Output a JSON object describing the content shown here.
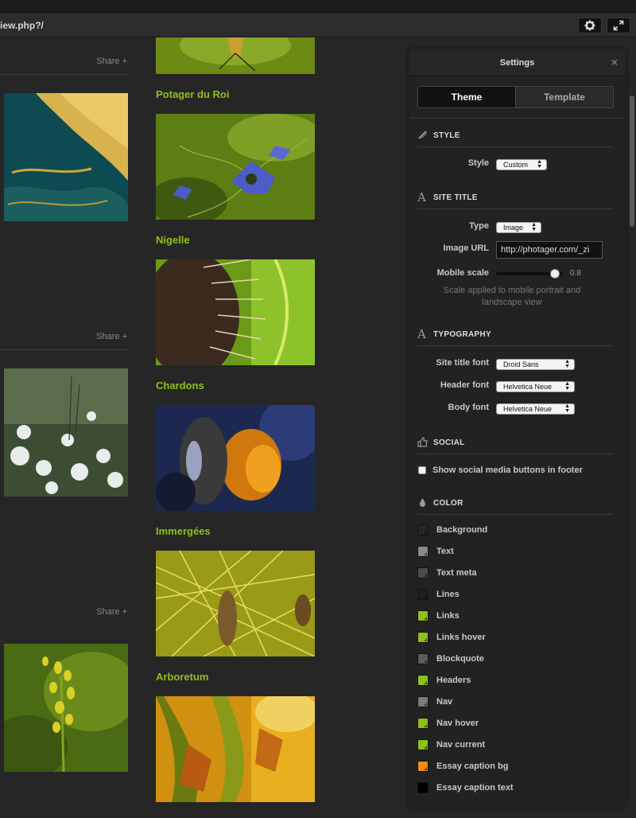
{
  "browser": {
    "url": "iew.php?/",
    "settings_button": "gear-icon",
    "fullscreen_button": "expand-icon"
  },
  "left_column": {
    "share_labels": [
      "Share +",
      "Share +",
      "Share +"
    ]
  },
  "gallery": {
    "titles": [
      "Potager du Roi",
      "Nigelle",
      "Chardons",
      "Immergées",
      "Arboretum"
    ]
  },
  "settings": {
    "title": "Settings",
    "close": "×",
    "tabs": [
      {
        "label": "Theme",
        "active": true
      },
      {
        "label": "Template",
        "active": false
      }
    ],
    "style_section": {
      "title": "STYLE",
      "icon": "brush-icon",
      "style_label": "Style",
      "style_value": "Custom"
    },
    "site_title_section": {
      "title": "SITE TITLE",
      "icon": "letter-a-icon",
      "type_label": "Type",
      "type_value": "Image",
      "image_url_label": "Image URL",
      "image_url_value": "http://photager.com/_zi",
      "mobile_scale_label": "Mobile scale",
      "mobile_scale_value": "0.8",
      "mobile_scale_fraction": 0.88,
      "hint": "Scale applied to mobile portrait and landscape view"
    },
    "typography_section": {
      "title": "TYPOGRAPHY",
      "icon": "letter-a-icon",
      "site_title_font_label": "Site title font",
      "site_title_font_value": "Droid Sans",
      "header_font_label": "Header font",
      "header_font_value": "Helvetica Neue",
      "body_font_label": "Body font",
      "body_font_value": "Helvetica Neue"
    },
    "social_section": {
      "title": "SOCIAL",
      "icon": "thumbs-up-icon",
      "checkbox_label": "Show social media buttons in footer",
      "checked": false
    },
    "color_section": {
      "title": "COLOR",
      "icon": "drop-icon",
      "items": [
        {
          "label": "Background",
          "color": "#262626"
        },
        {
          "label": "Text",
          "color": "#8a8a8a"
        },
        {
          "label": "Text meta",
          "color": "#4a4a4a"
        },
        {
          "label": "Lines",
          "color": "#1e1e1e"
        },
        {
          "label": "Links",
          "color": "#8fbf1a"
        },
        {
          "label": "Links hover",
          "color": "#8fbf1a"
        },
        {
          "label": "Blockquote",
          "color": "#5c5c5c"
        },
        {
          "label": "Headers",
          "color": "#8fbf1a"
        },
        {
          "label": "Nav",
          "color": "#7a7a7a"
        },
        {
          "label": "Nav hover",
          "color": "#8fbf1a"
        },
        {
          "label": "Nav current",
          "color": "#8fbf1a"
        },
        {
          "label": "Essay caption bg",
          "color": "#f08c10"
        },
        {
          "label": "Essay caption text",
          "color": "#000000"
        }
      ]
    }
  }
}
